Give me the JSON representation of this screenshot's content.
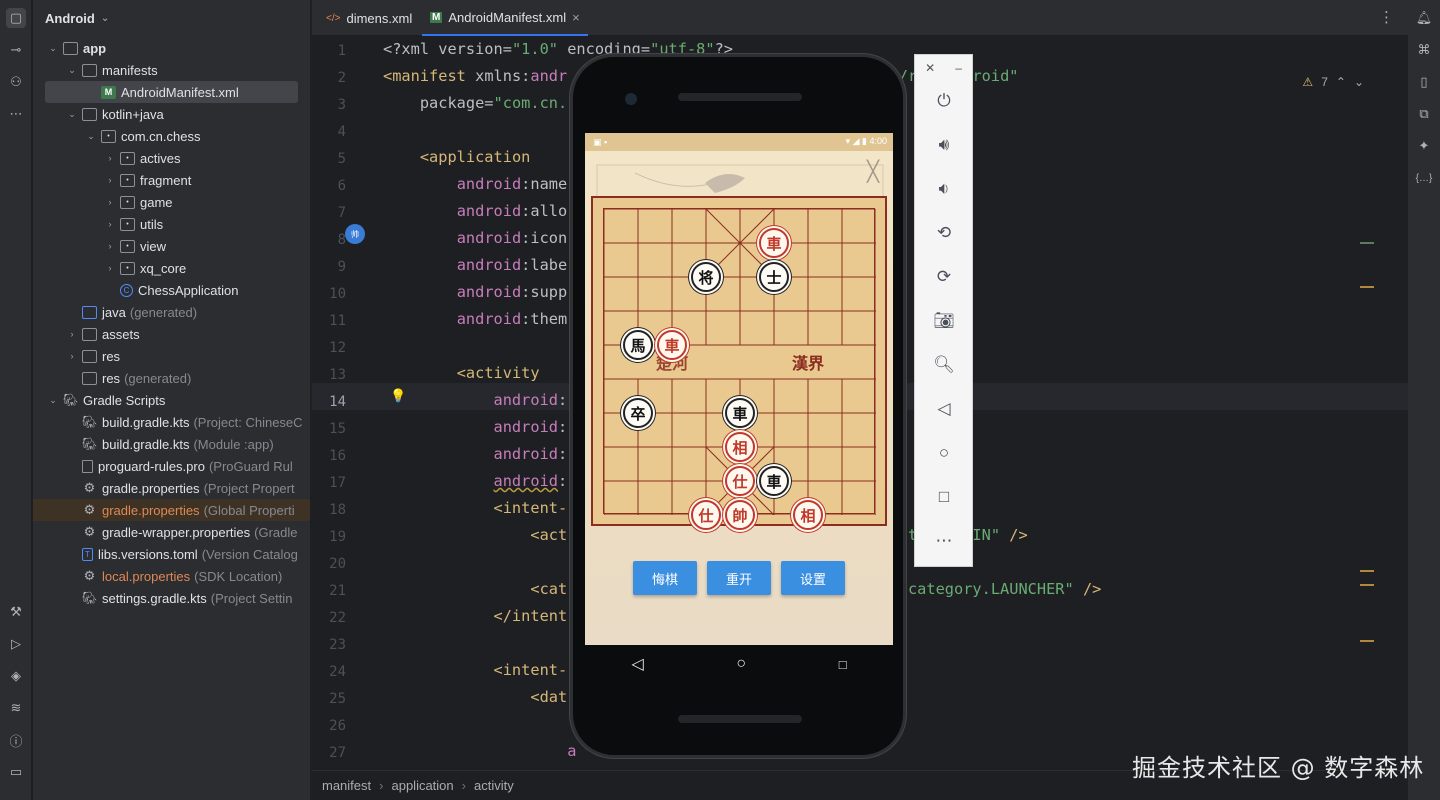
{
  "project": {
    "title": "Android",
    "tree": [
      {
        "label": "app",
        "dim": "",
        "type": "modfolder",
        "level": 0,
        "arrow": "down",
        "bold": true
      },
      {
        "label": "manifests",
        "dim": "",
        "type": "folder",
        "level": 1,
        "arrow": "down"
      },
      {
        "label": "AndroidManifest.xml",
        "dim": "",
        "type": "xml",
        "level": 2,
        "arrow": "",
        "sel": true
      },
      {
        "label": "kotlin+java",
        "dim": "",
        "type": "folder",
        "level": 1,
        "arrow": "down"
      },
      {
        "label": "com.cn.chess",
        "dim": "",
        "type": "pkg",
        "level": 2,
        "arrow": "down"
      },
      {
        "label": "actives",
        "dim": "",
        "type": "pkg",
        "level": 3,
        "arrow": "right"
      },
      {
        "label": "fragment",
        "dim": "",
        "type": "pkg",
        "level": 3,
        "arrow": "right"
      },
      {
        "label": "game",
        "dim": "",
        "type": "pkg",
        "level": 3,
        "arrow": "right"
      },
      {
        "label": "utils",
        "dim": "",
        "type": "pkg",
        "level": 3,
        "arrow": "right"
      },
      {
        "label": "view",
        "dim": "",
        "type": "pkg",
        "level": 3,
        "arrow": "right"
      },
      {
        "label": "xq_core",
        "dim": "",
        "type": "pkg",
        "level": 3,
        "arrow": "right"
      },
      {
        "label": "ChessApplication",
        "dim": "",
        "type": "cls",
        "level": 3,
        "arrow": ""
      },
      {
        "label": "java",
        "dim": "(generated)",
        "type": "srcfolder",
        "level": 1,
        "arrow": ""
      },
      {
        "label": "assets",
        "dim": "",
        "type": "folder",
        "level": 1,
        "arrow": "right"
      },
      {
        "label": "res",
        "dim": "",
        "type": "folder",
        "level": 1,
        "arrow": "right"
      },
      {
        "label": "res",
        "dim": "(generated)",
        "type": "folder",
        "level": 1,
        "arrow": ""
      },
      {
        "label": "Gradle Scripts",
        "dim": "",
        "type": "gradle",
        "level": 0,
        "arrow": "down"
      },
      {
        "label": "build.gradle.kts",
        "dim": "(Project: ChineseC",
        "type": "gradle",
        "level": 1,
        "arrow": ""
      },
      {
        "label": "build.gradle.kts",
        "dim": "(Module :app)",
        "type": "gradle",
        "level": 1,
        "arrow": ""
      },
      {
        "label": "proguard-rules.pro",
        "dim": "(ProGuard Rul",
        "type": "file",
        "level": 1,
        "arrow": ""
      },
      {
        "label": "gradle.properties",
        "dim": "(Project Propert",
        "type": "gear",
        "level": 1,
        "arrow": ""
      },
      {
        "label": "gradle.properties",
        "dim": "(Global Properti",
        "type": "gear",
        "level": 1,
        "arrow": "",
        "orange": true,
        "hl": true
      },
      {
        "label": "gradle-wrapper.properties",
        "dim": "(Gradle",
        "type": "gear",
        "level": 1,
        "arrow": ""
      },
      {
        "label": "libs.versions.toml",
        "dim": "(Version Catalog",
        "type": "toml",
        "level": 1,
        "arrow": ""
      },
      {
        "label": "local.properties",
        "dim": "(SDK Location)",
        "type": "gear",
        "level": 1,
        "arrow": "",
        "orange": true
      },
      {
        "label": "settings.gradle.kts",
        "dim": "(Project Settin",
        "type": "gradle",
        "level": 1,
        "arrow": ""
      }
    ]
  },
  "tabs": [
    {
      "label": "dimens.xml",
      "icon": "</>"
    },
    {
      "label": "AndroidManifest.xml",
      "icon": "M",
      "close": "×"
    }
  ],
  "inspections": {
    "warnings": "7"
  },
  "code": [
    "<span class='p'>&lt;?xml version=</span><span class='s'>\"1.0\"</span><span class='p'> encoding=</span><span class='s'>\"utf-8\"</span><span class='p'>?&gt;</span>",
    "<span class='t'>&lt;manifest</span> <span class='p'>xmlns:</span><span class='a'>andr</span>                                   <span class='s'>k/res/android\"</span>",
    "    <span class='p'>package=</span><span class='s'>\"com.cn.</span>",
    "",
    "    <span class='t'>&lt;application</span>",
    "        <span class='a'>android</span><span class='p'>:name</span>",
    "        <span class='a'>android</span><span class='p'>:allo</span>",
    "        <span class='a'>android</span><span class='p'>:icon</span>",
    "        <span class='a'>android</span><span class='p'>:labe</span>",
    "        <span class='a'>android</span><span class='p'>:supp</span>",
    "        <span class='a'>android</span><span class='p'>:them</span>",
    "",
    "        <span class='t'>&lt;activity</span>",
    "            <span class='a'>android</span><span class='p'>:</span>                                      <span class='s'>e\"</span>",
    "            <span class='a'>android</span><span class='p'>:</span>",
    "            <span class='a'>android</span><span class='p'>:</span>",
    "            <span class='a' style='text-decoration:underline wavy #b99a3f'>android</span><span class='p'>:</span>",
    "            <span class='t'>&lt;intent-</span>",
    "                <span class='t'>&lt;act</span>                                    <span class='s'>ction.MAIN\"</span> <span class='t'>/&gt;</span>",
    "",
    "                <span class='t'>&lt;cat</span>                                    <span class='s'>.category.LAUNCHER\"</span> <span class='t'>/&gt;</span>",
    "            <span class='t'>&lt;/intent</span>",
    "",
    "            <span class='t'>&lt;intent-</span>",
    "                <span class='t'>&lt;dat</span>",
    "",
    "                    <span class='a'>a</span>"
  ],
  "breadcrumb": [
    "manifest",
    "application",
    "activity"
  ],
  "game": {
    "statusTime": "4:00",
    "river": [
      "楚河",
      "漢界"
    ],
    "buttons": [
      "悔棋",
      "重开",
      "设置"
    ],
    "pieces": [
      {
        "ch": "車",
        "color": "red",
        "col": 5,
        "row": 1
      },
      {
        "ch": "将",
        "color": "black",
        "col": 3,
        "row": 2
      },
      {
        "ch": "士",
        "color": "black",
        "col": 5,
        "row": 2
      },
      {
        "ch": "馬",
        "color": "black",
        "col": 1,
        "row": 4
      },
      {
        "ch": "車",
        "color": "red",
        "col": 2,
        "row": 4
      },
      {
        "ch": "卒",
        "color": "black",
        "col": 1,
        "row": 6
      },
      {
        "ch": "車",
        "color": "black",
        "col": 4,
        "row": 6
      },
      {
        "ch": "相",
        "color": "red",
        "col": 4,
        "row": 7
      },
      {
        "ch": "仕",
        "color": "red",
        "col": 4,
        "row": 8
      },
      {
        "ch": "車",
        "color": "black",
        "col": 5,
        "row": 8
      },
      {
        "ch": "仕",
        "color": "red",
        "col": 3,
        "row": 9
      },
      {
        "ch": "帥",
        "color": "red",
        "col": 4,
        "row": 9
      },
      {
        "ch": "相",
        "color": "red",
        "col": 6,
        "row": 9
      }
    ]
  },
  "watermark": "掘金技术社区 @ 数字森林"
}
